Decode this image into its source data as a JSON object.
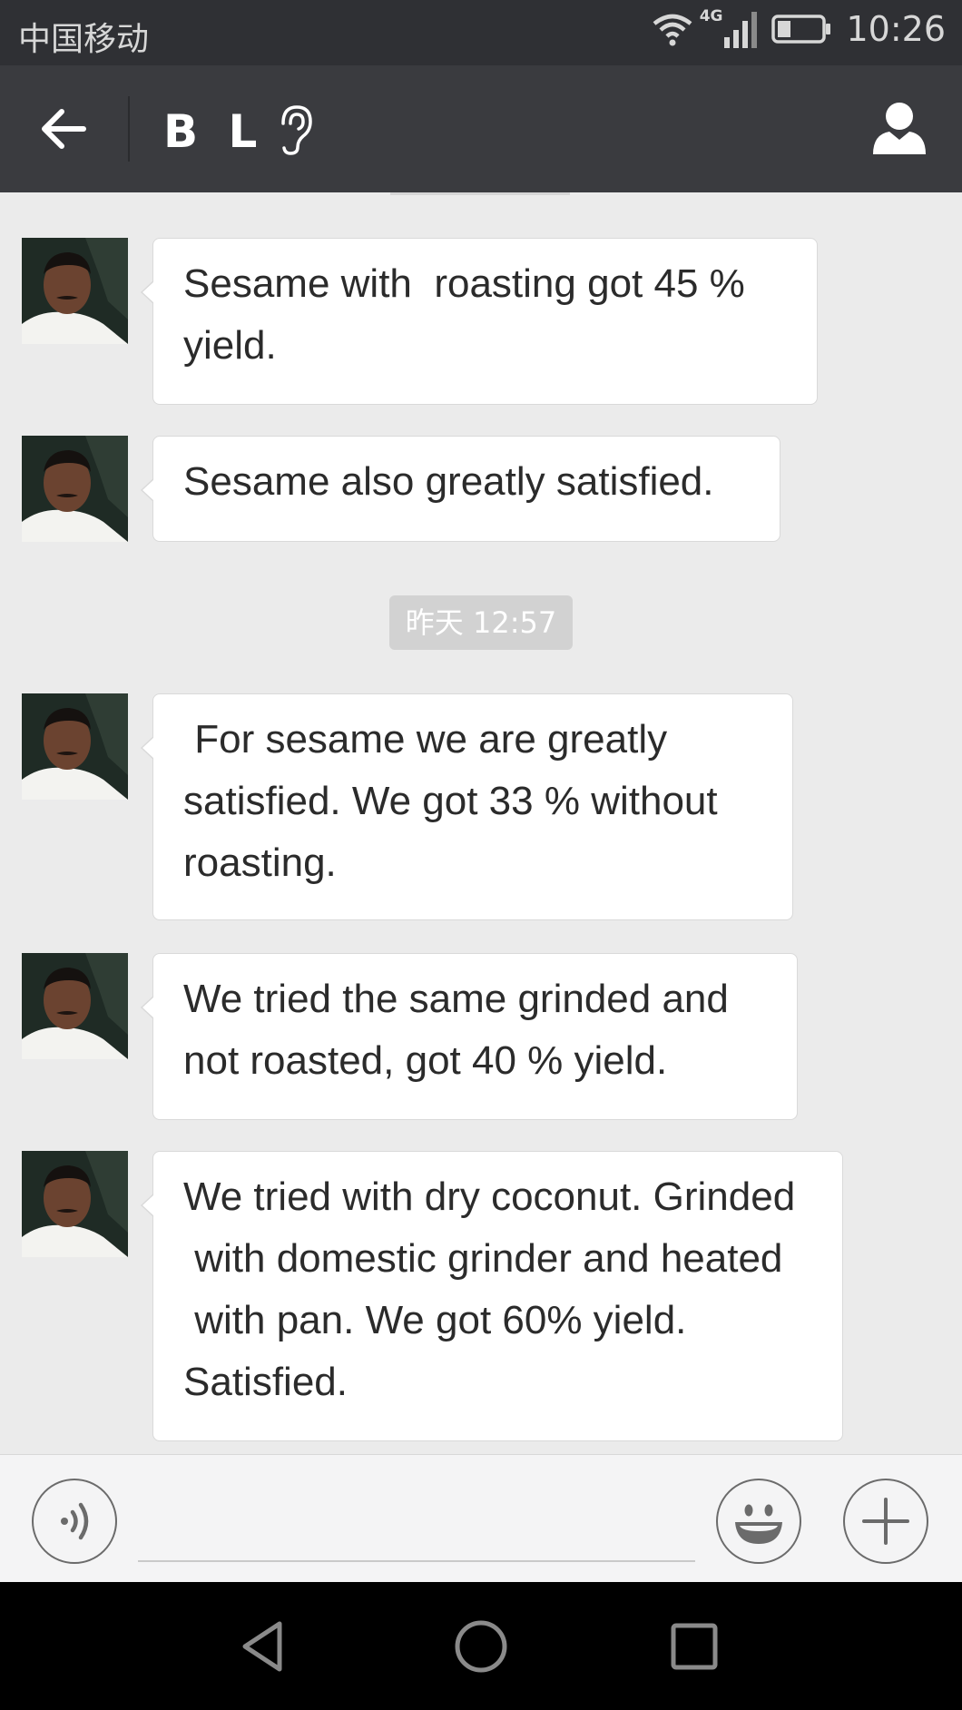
{
  "status_bar": {
    "carrier": "中国移动",
    "network": "4G",
    "time": "10:26"
  },
  "header": {
    "title": "B L",
    "back_icon": "arrow-left-icon",
    "ear_icon": "ear-icon",
    "profile_icon": "person-icon"
  },
  "messages": [
    {
      "text": "Sesame with  roasting got 45 %\nyield."
    },
    {
      "text": "Sesame also greatly satisfied."
    },
    {
      "text": " For sesame we are greatly\nsatisfied. We got 33 % without\nroasting."
    },
    {
      "text": "We tried the same grinded and\nnot roasted, got 40 % yield."
    },
    {
      "text": "We tried with dry coconut. Grinded\n with domestic grinder and heated\n with pan. We got 60% yield.\nSatisfied."
    }
  ],
  "timestamp": "昨天 12:57",
  "input_bar": {
    "voice_icon": "voice-icon",
    "emoji_icon": "emoji-icon",
    "plus_icon": "plus-icon",
    "placeholder": ""
  },
  "nav_bar": {
    "back_icon": "nav-back-icon",
    "home_icon": "nav-home-icon",
    "recents_icon": "nav-recents-icon"
  }
}
